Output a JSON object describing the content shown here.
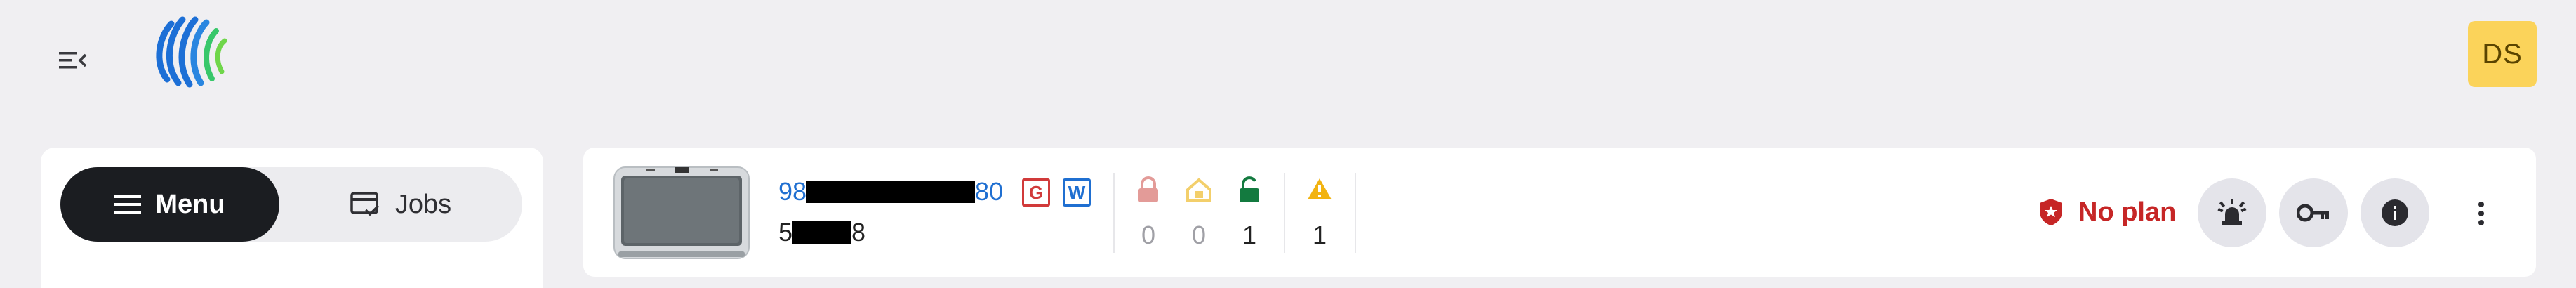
{
  "header": {
    "user_initials": "DS"
  },
  "sidebar": {
    "tabs": [
      {
        "label": "Menu",
        "icon": "hamburger-icon",
        "active": true
      },
      {
        "label": "Jobs",
        "icon": "jobs-card-check-icon",
        "active": false
      }
    ]
  },
  "device": {
    "serial_prefix": "98",
    "serial_suffix": "80",
    "badges": [
      "G",
      "W"
    ],
    "name_prefix": "5",
    "name_suffix": "8",
    "stats": [
      {
        "icon": "locked-icon",
        "count": "0",
        "color": "#e39b98"
      },
      {
        "icon": "home-lock-icon",
        "count": "0",
        "color": "#f3cf6b"
      },
      {
        "icon": "unlocked-icon",
        "count": "1",
        "color": "#137a3f"
      },
      {
        "icon": "warning-icon",
        "count": "1",
        "color": "#f2b310"
      }
    ],
    "plan_status": "No plan"
  },
  "colors": {
    "accent_blue": "#1f6fd1",
    "danger_red": "#c62626",
    "avatar_bg": "#fbd35a",
    "dark_tab": "#1b1d21"
  }
}
